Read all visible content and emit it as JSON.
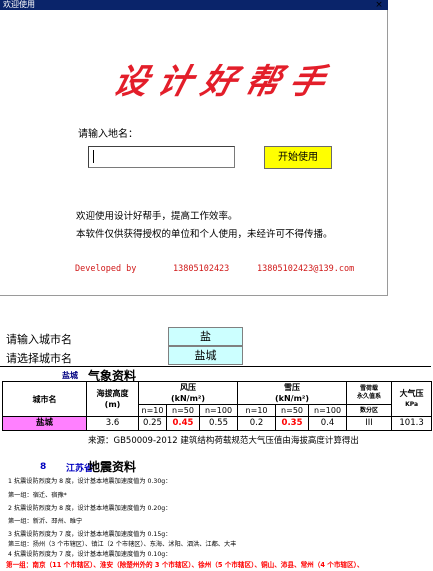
{
  "dialog": {
    "title": "欢迎使用",
    "close_glyph": "×",
    "logo_text": "设计好帮手",
    "prompt": "请输入地名：",
    "input_value": "",
    "start_button": "开始使用",
    "intro_line1": "欢迎使用设计好帮手，提高工作效率。",
    "intro_line2": "本软件仅供获得授权的单位和个人使用，未经许可不得传播。",
    "developed_by": "Developed by",
    "phone": "13805102423",
    "email": "13805102423@139.com"
  },
  "sheet": {
    "city_prompt_label": "请输入城市名",
    "city_input": "盐",
    "city_select_label": "请选择城市名",
    "city_selected": "盐城"
  },
  "weather": {
    "city": "盐城",
    "heading": "气象资料",
    "col_city": "城市名",
    "col_altitude": "海拔高度",
    "col_altitude_unit": "(m)",
    "col_wind": "风压",
    "col_wind_unit": "(kN/m²)",
    "col_snow": "雪压",
    "col_snow_unit": "(kN/m²)",
    "col_snow_zone": "雪荷载",
    "col_snow_zone2": "永久值系",
    "col_snow_zone3": "数分区",
    "col_pressure": "大气压",
    "col_pressure_unit": "KPa",
    "n10": "n=10",
    "n50": "n=50",
    "n100": "n=100",
    "row_city": "盐城",
    "altitude": "3.6",
    "wind_10": "0.25",
    "wind_50": "0.45",
    "wind_100": "0.55",
    "snow_10": "0.2",
    "snow_50": "0.35",
    "snow_100": "0.4",
    "zone": "III",
    "pressure": "101.3",
    "source": "来源：GB50009-2012 建筑结构荷载规范大气压值由海拔高度计算得出"
  },
  "seismic": {
    "number": "8",
    "province": "江苏省",
    "title": "地震资料",
    "lines": [
      "1  抗震设防烈度为 8 度，设计基本地震加速度值为 0.30g：",
      "第一组：宿迁、宿豫*",
      "2  抗震设防烈度为 8 度，设计基本地震加速度值为 0.20g：",
      "第一组：新沂、邳州、睢宁",
      "3  抗震设防烈度为 7 度，设计基本地震加速度值为 0.15g：",
      "第三组：扬州（3 个市辖区）、镇江（2 个市辖区）、东海、沭阳、泗洪、江都、大丰",
      "4  抗震设防烈度为 7 度，设计基本地震加速度值为 0.10g："
    ],
    "last_line": "第一组：南京（11 个市辖区）、淮安（除楚州外的 3 个市辖区）、徐州（5 个市辖区）、铜山、沛县、常州（4 个市辖区）、"
  }
}
